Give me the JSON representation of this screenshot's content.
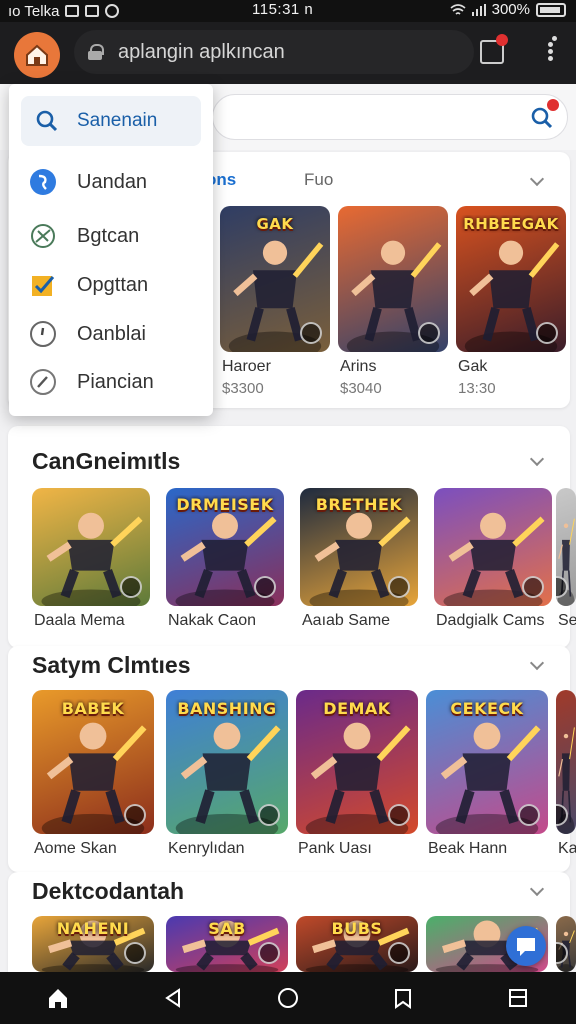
{
  "status_bar": {
    "carrier": "ıo Telka",
    "time": "115:31 n",
    "battery": "300%"
  },
  "topbar": {
    "url": "aplangin aplkıncan"
  },
  "dropdown": {
    "search_label": "Sanenain",
    "items": [
      {
        "label": "Uandan",
        "icon": "globe-icon"
      },
      {
        "label": "Bgtcan",
        "icon": "sync-icon"
      },
      {
        "label": "Opgttan",
        "icon": "check-box-icon"
      },
      {
        "label": "Oanblai",
        "icon": "clock-icon"
      },
      {
        "label": "Piancian",
        "icon": "compass-icon"
      }
    ]
  },
  "featured": {
    "tab_active": "ons",
    "tab_other": "Fuo",
    "games": [
      {
        "title": "Haroer",
        "price": "$3300",
        "art_text": "GAK",
        "colors": [
          "#2f3d64",
          "#7a5f3b"
        ]
      },
      {
        "title": "Arins",
        "price": "$3040",
        "art_text": "",
        "colors": [
          "#e86a32",
          "#33426a"
        ]
      },
      {
        "title": "Gak",
        "price": "13:30",
        "art_text": "RHBEEGAK",
        "colors": [
          "#d8521f",
          "#3a1d2a"
        ]
      }
    ]
  },
  "section1": {
    "title": "CanGneimıtls",
    "games": [
      {
        "title": "Daala Mema",
        "art_text": "",
        "colors": [
          "#f1b546",
          "#5d7a3a"
        ]
      },
      {
        "title": "Nakak Caon",
        "art_text": "DRMEISEK",
        "colors": [
          "#2a68c9",
          "#8a2f5a"
        ]
      },
      {
        "title": "Aaıab Same",
        "art_text": "BRETHEK",
        "colors": [
          "#1e2a3e",
          "#e8a53a"
        ]
      },
      {
        "title": "Dadgialk Cams",
        "art_text": "",
        "colors": [
          "#7b4fbf",
          "#e2704a"
        ]
      },
      {
        "title": "Se",
        "art_text": "",
        "colors": [
          "#c9c9c9",
          "#9a9a9a"
        ]
      }
    ]
  },
  "section2": {
    "title": "Satym Clmtıes",
    "games": [
      {
        "title": "Aome Skan",
        "art_text": "BABEK",
        "colors": [
          "#e99a2a",
          "#8c2e1c"
        ]
      },
      {
        "title": "Kenrylıdan",
        "art_text": "BANSHING",
        "colors": [
          "#3f7fd6",
          "#57a86a"
        ]
      },
      {
        "title": "Pank Uası",
        "art_text": "DEMAK",
        "colors": [
          "#6a2a8a",
          "#d44a2a"
        ]
      },
      {
        "title": "Beak Hann",
        "art_text": "CEKECK",
        "colors": [
          "#4a8ed6",
          "#c44a8a"
        ]
      },
      {
        "title": "Ka",
        "art_text": "",
        "colors": [
          "#a03a2a",
          "#4a4a6a"
        ]
      }
    ]
  },
  "section3": {
    "title": "Dektcodantah",
    "games": [
      {
        "art_text": "NAHENI",
        "colors": [
          "#e8a53a",
          "#2a2a2a"
        ]
      },
      {
        "art_text": "SAB",
        "colors": [
          "#4a3ab0",
          "#d0405a"
        ]
      },
      {
        "art_text": "BUBS",
        "colors": [
          "#c04a2a",
          "#2a1a1a"
        ]
      },
      {
        "art_text": "",
        "colors": [
          "#4ab06a",
          "#d04a8a"
        ]
      },
      {
        "art_text": "",
        "colors": [
          "#8a6a4a",
          "#3a3a3a"
        ]
      }
    ]
  }
}
